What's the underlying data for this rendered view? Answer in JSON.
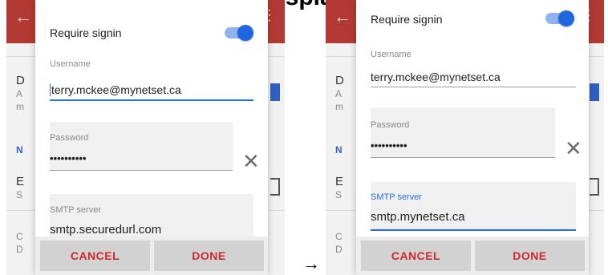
{
  "caption": "Display",
  "arrow": "→",
  "background": {
    "letters_left": [
      "D",
      "A",
      "m",
      "N",
      "E",
      "S",
      "C",
      "D"
    ],
    "letters_right": [
      "D",
      "A",
      "m",
      "N",
      "E",
      "S",
      "C",
      "D"
    ]
  },
  "left": {
    "require_signin_label": "Require signin",
    "username_label": "Username",
    "username_value": "terry.mckee@mynetset.ca",
    "password_label": "Password",
    "password_value": "••••••••••",
    "smtp_label": "SMTP server",
    "smtp_value": "smtp.securedurl.com",
    "cancel_label": "CANCEL",
    "done_label": "DONE"
  },
  "right": {
    "require_signin_label": "Require signin",
    "username_label": "Username",
    "username_value": "terry.mckee@mynetset.ca",
    "password_label": "Password",
    "password_value": "••••••••••",
    "smtp_label": "SMTP server",
    "smtp_value": "smtp.mynetset.ca",
    "cancel_label": "CANCEL",
    "done_label": "DONE"
  },
  "colors": {
    "appbar": "#b33a34",
    "accent_blue": "#1e67e0",
    "button_text": "#cf2a2a"
  },
  "icons": {
    "back": "arrow-left-icon",
    "menu": "more-vertical-icon",
    "clear": "close-icon"
  }
}
